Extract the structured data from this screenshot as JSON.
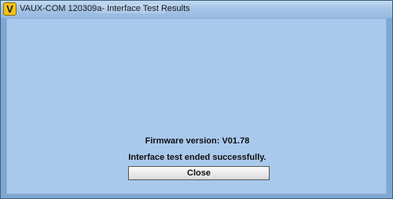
{
  "window": {
    "title": "VAUX-COM 120309a- Interface Test Results",
    "icon_letter": "V",
    "icon_name": "vaux-com-app-icon"
  },
  "results": {
    "firmware_version": "Firmware version: V01.78",
    "message": "Interface test ended successfully."
  },
  "actions": {
    "close_label": "Close"
  },
  "colors": {
    "client_background": "#a9c9ec",
    "titlebar": "#a8c6e8",
    "icon": "#f2c11a"
  }
}
